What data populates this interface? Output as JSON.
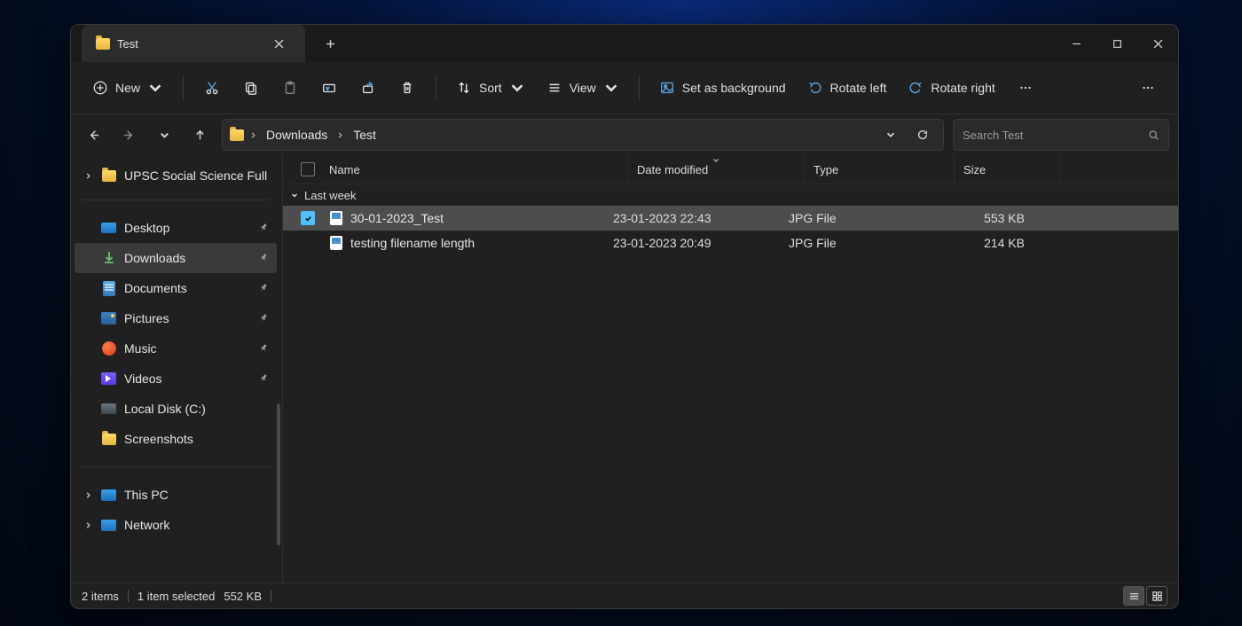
{
  "tab": {
    "title": "Test"
  },
  "toolbar": {
    "new": "New",
    "sort": "Sort",
    "view": "View",
    "set_bg": "Set as background",
    "rotate_left": "Rotate left",
    "rotate_right": "Rotate right"
  },
  "breadcrumbs": [
    "Downloads",
    "Test"
  ],
  "search": {
    "placeholder": "Search Test"
  },
  "sidebar": {
    "top_item": "UPSC Social Science Full",
    "quick": [
      {
        "label": "Desktop",
        "icon": "desktop",
        "pinned": true
      },
      {
        "label": "Downloads",
        "icon": "download",
        "pinned": true,
        "active": true
      },
      {
        "label": "Documents",
        "icon": "document",
        "pinned": true
      },
      {
        "label": "Pictures",
        "icon": "picture",
        "pinned": true
      },
      {
        "label": "Music",
        "icon": "music",
        "pinned": true
      },
      {
        "label": "Videos",
        "icon": "video",
        "pinned": true
      },
      {
        "label": "Local Disk (C:)",
        "icon": "drive",
        "pinned": false
      },
      {
        "label": "Screenshots",
        "icon": "folder",
        "pinned": false
      }
    ],
    "bottom": [
      {
        "label": "This PC",
        "icon": "pc"
      },
      {
        "label": "Network",
        "icon": "network"
      }
    ]
  },
  "columns": {
    "name": "Name",
    "date": "Date modified",
    "type": "Type",
    "size": "Size"
  },
  "group": {
    "label": "Last week"
  },
  "files": [
    {
      "name": "30-01-2023_Test",
      "date": "23-01-2023 22:43",
      "type": "JPG File",
      "size": "553 KB",
      "selected": true
    },
    {
      "name": "testing filename length",
      "date": "23-01-2023 20:49",
      "type": "JPG File",
      "size": "214 KB",
      "selected": false
    }
  ],
  "status": {
    "items": "2 items",
    "selected": "1 item selected",
    "sel_size": "552 KB"
  }
}
